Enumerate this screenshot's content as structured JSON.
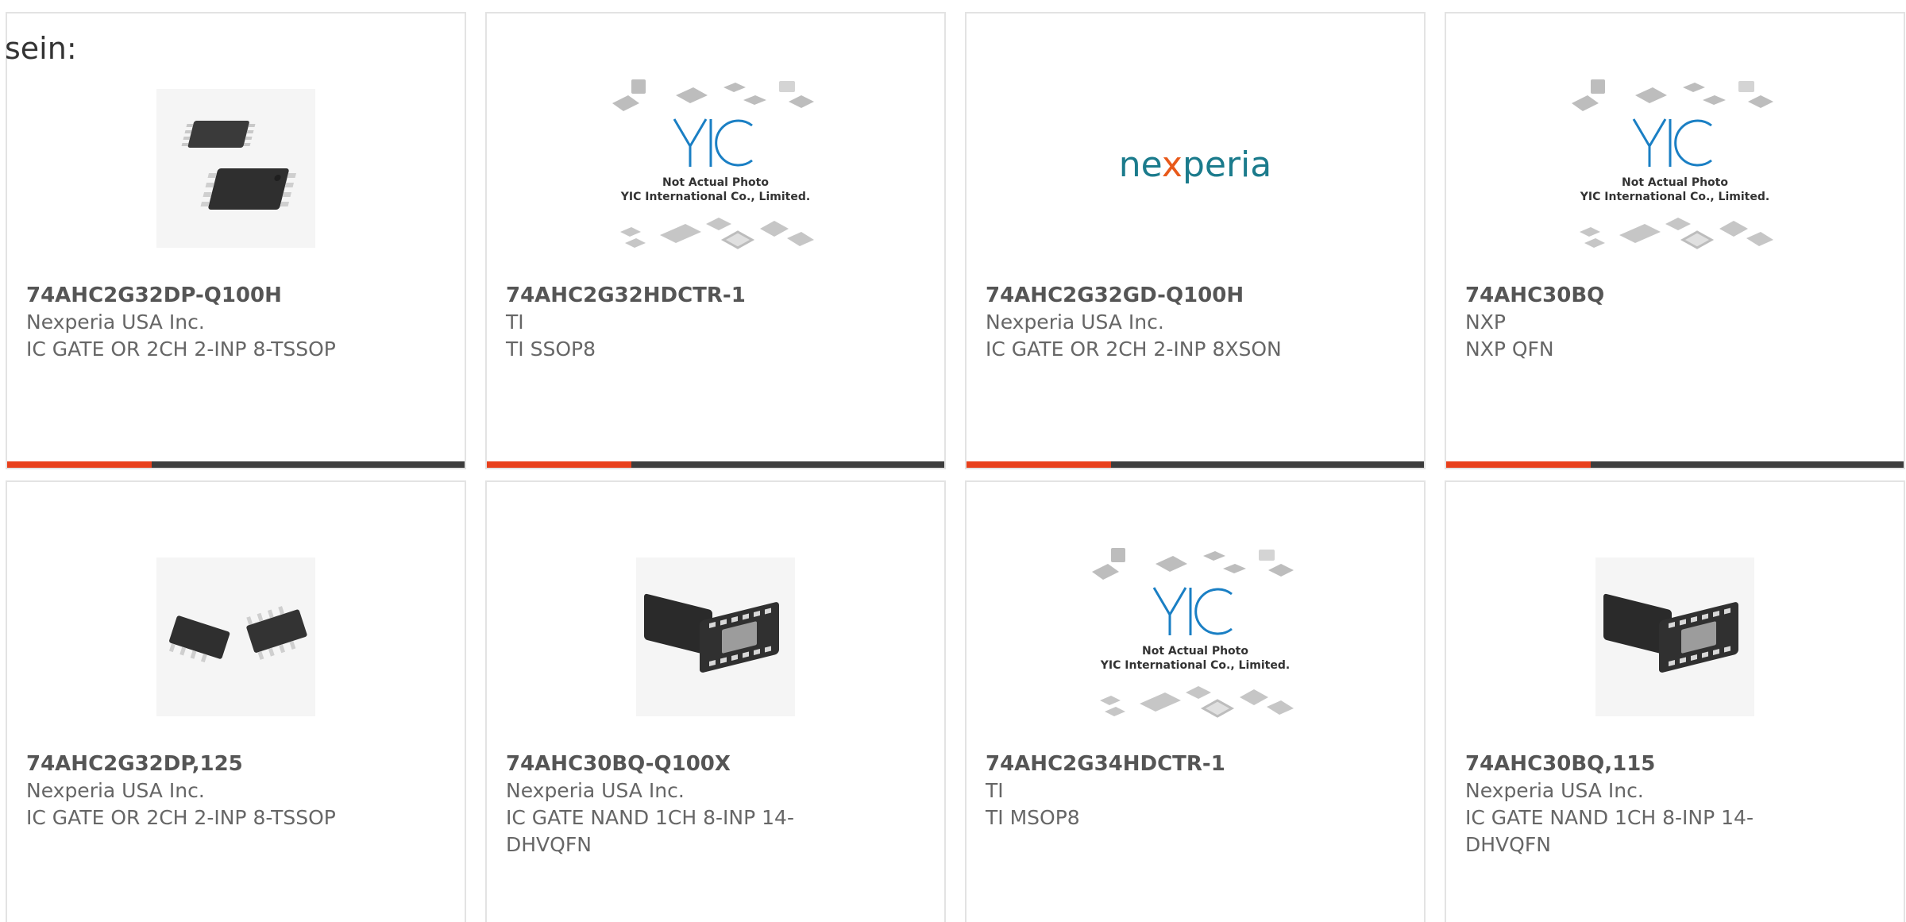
{
  "intro_text": "sein:",
  "colors": {
    "accent": "#e8401c",
    "bar": "#3c3c3c",
    "border": "#e3e3e3",
    "title": "#555555",
    "text": "#666666",
    "yic_blue": "#1a7fc4",
    "nexperia_teal": "#1b7b8c",
    "nexperia_orange": "#e8591a"
  },
  "placeholder_image": {
    "line1": "Not Actual Photo",
    "line2": "YIC International Co., Limited."
  },
  "brand_logo": {
    "text_before": "ne",
    "text_mark": "x",
    "text_after": "peria"
  },
  "products": [
    {
      "part_number": "74AHC2G32DP-Q100H",
      "manufacturer": "Nexperia USA Inc.",
      "description": "IC GATE OR 2CH 2-INP 8-TSSOP",
      "image": "tssop-8-photo"
    },
    {
      "part_number": "74AHC2G32HDCTR-1",
      "manufacturer": "TI",
      "description": "TI SSOP8",
      "image": "not-actual-photo-placeholder"
    },
    {
      "part_number": "74AHC2G32GD-Q100H",
      "manufacturer": "Nexperia USA Inc.",
      "description": "IC GATE OR 2CH 2-INP 8XSON",
      "image": "nexperia-logo"
    },
    {
      "part_number": "74AHC30BQ",
      "manufacturer": "NXP",
      "description": "NXP QFN",
      "image": "not-actual-photo-placeholder"
    },
    {
      "part_number": "74AHC2G32DP,125",
      "manufacturer": "Nexperia USA Inc.",
      "description": "IC GATE OR 2CH 2-INP 8-TSSOP",
      "image": "tssop-8-photo"
    },
    {
      "part_number": "74AHC30BQ-Q100X",
      "manufacturer": "Nexperia USA Inc.",
      "description": "IC GATE NAND 1CH 8-INP 14-DHVQFN",
      "image": "dhvqfn-14-photo"
    },
    {
      "part_number": "74AHC2G34HDCTR-1",
      "manufacturer": "TI",
      "description": "TI MSOP8",
      "image": "not-actual-photo-placeholder"
    },
    {
      "part_number": "74AHC30BQ,115",
      "manufacturer": "Nexperia USA Inc.",
      "description": "IC GATE NAND 1CH 8-INP 14-DHVQFN",
      "image": "dhvqfn-14-photo"
    }
  ]
}
